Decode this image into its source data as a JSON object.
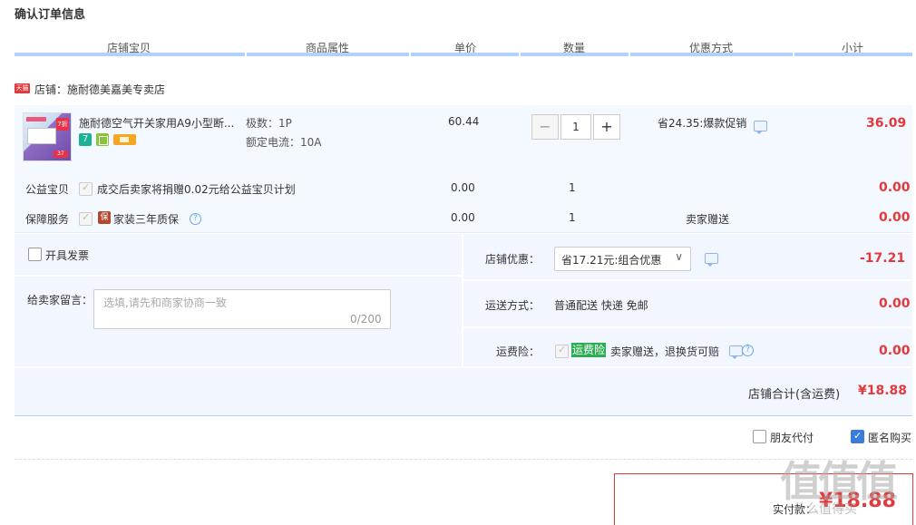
{
  "page_title": "确认订单信息",
  "columns": [
    "店铺宝贝",
    "商品属性",
    "单价",
    "数量",
    "优惠方式",
    "小计"
  ],
  "store": {
    "icon_text": "天猫",
    "label": "店铺：施耐德美嘉美专卖店"
  },
  "item": {
    "thumb_badge": "7折",
    "thumb_price": "37",
    "name": "施耐德空气开关家用A9小型断...",
    "attr1": "极数：1P",
    "attr2": "额定电流：10A",
    "unit_price": "60.44",
    "quantity": "1",
    "qty_minus": "−",
    "qty_plus": "+",
    "discount": "省24.35:爆款促销",
    "subtotal": "36.09",
    "badge_7": "7"
  },
  "extras": [
    {
      "label": "公益宝贝",
      "desc": "成交后卖家将捐赠0.02元给公益宝贝计划",
      "price": "0.00",
      "qty": "1",
      "discount": "",
      "subtotal": "0.00"
    },
    {
      "label": "保障服务",
      "desc": "家装三年质保",
      "price": "0.00",
      "qty": "1",
      "discount": "卖家赠送",
      "subtotal": "0.00",
      "icon": "保"
    }
  ],
  "invoice": {
    "label": "开具发票"
  },
  "remark": {
    "label": "给卖家留言：",
    "placeholder": "选填,请先和商家协商一致",
    "count": "0/200"
  },
  "store_discount": {
    "label": "店铺优惠：",
    "selected": "省17.21元:组合优惠",
    "arrow": "∨",
    "amount": "-17.21"
  },
  "shipping": {
    "label": "运送方式：",
    "value": "普通配送 快递 免邮",
    "amount": "0.00"
  },
  "freight_insurance": {
    "label": "运费险：",
    "badge": "运费险",
    "desc": "卖家赠送，退换货可赔",
    "amount": "0.00",
    "help": "?"
  },
  "store_total": {
    "label": "店铺合计(含运费)",
    "amount": "¥18.88"
  },
  "options": {
    "friend_pay": "朋友代付",
    "anonymous": "匿名购买"
  },
  "final": {
    "label": "实付款：",
    "amount": "¥18.88"
  },
  "watermark": {
    "logo": "值值值",
    "text": "什么值得买"
  },
  "colors": {
    "accent_red": "#e4393c",
    "header_line": "#b2d1ff",
    "panel_bg": "#f2f6fe",
    "green": "#2eae52"
  }
}
